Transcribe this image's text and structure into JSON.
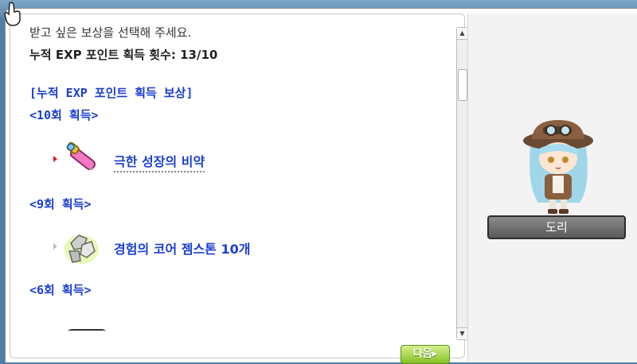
{
  "dialog": {
    "instruction": "받고 싶은 보상을 선택해 주세요.",
    "count_line": "누적 EXP 포인트 획득 횟수: 13/10",
    "section_header": "[누적 EXP 포인트 획득 보상]",
    "tiers": [
      {
        "label": "<10회 획득>",
        "reward": "극한 성장의 비약"
      },
      {
        "label": "<9회 획득>",
        "reward": "경험의 코어 젬스톤 10개"
      },
      {
        "label": "<6회 획득>"
      }
    ],
    "next_button": "다음▸"
  },
  "npc": {
    "name": "도리"
  },
  "colors": {
    "link_blue": "#1a3fd0",
    "next_button_green": "#84c226",
    "selection_arrow": "#d21f1f"
  }
}
